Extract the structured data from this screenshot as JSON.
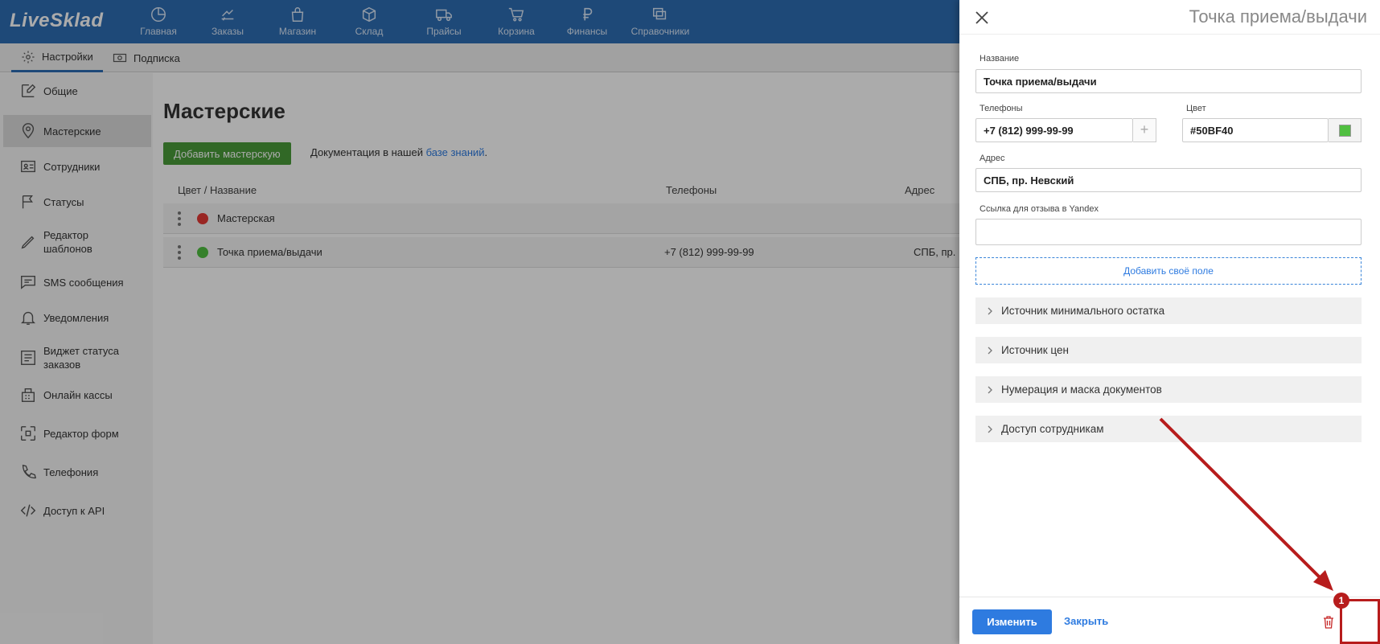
{
  "app": {
    "logo": "LiveSklad"
  },
  "nav": [
    {
      "label": "Главная",
      "icon": "dashboard-icon"
    },
    {
      "label": "Заказы",
      "icon": "orders-icon"
    },
    {
      "label": "Магазин",
      "icon": "shop-bag-icon"
    },
    {
      "label": "Склад",
      "icon": "box-icon"
    },
    {
      "label": "Прайсы",
      "icon": "truck-icon"
    },
    {
      "label": "Корзина",
      "icon": "cart-icon"
    },
    {
      "label": "Финансы",
      "icon": "ruble-icon"
    },
    {
      "label": "Справочники",
      "icon": "directory-icon"
    }
  ],
  "subnav": {
    "settings": "Настройки",
    "subscription": "Подписка"
  },
  "sidebar": {
    "items": [
      {
        "label": "Общие",
        "icon": "edit-icon"
      },
      {
        "label": "Мастерские",
        "icon": "location-pin-icon"
      },
      {
        "label": "Сотрудники",
        "icon": "id-card-icon"
      },
      {
        "label": "Статусы",
        "icon": "flag-icon"
      },
      {
        "label": "Редактор шаблонов",
        "icon": "pen-icon"
      },
      {
        "label": "SMS сообщения",
        "icon": "sms-icon"
      },
      {
        "label": "Уведомления",
        "icon": "bell-icon"
      },
      {
        "label": "Виджет статуса заказов",
        "icon": "widget-icon"
      },
      {
        "label": "Онлайн кассы",
        "icon": "cash-register-icon"
      },
      {
        "label": "Редактор форм",
        "icon": "form-editor-icon"
      },
      {
        "label": "Телефония",
        "icon": "phone-icon"
      },
      {
        "label": "Доступ к API",
        "icon": "code-icon"
      }
    ]
  },
  "main": {
    "title": "Мастерские",
    "add_button": "Добавить мастерскую",
    "docs_prefix": "Документация в нашей ",
    "docs_link": "базе знаний",
    "docs_suffix": ".",
    "columns": [
      "Цвет / Название",
      "Телефоны",
      "Адрес"
    ],
    "rows": [
      {
        "name": "Мастерская",
        "color": "#e53935",
        "phone": "",
        "address": ""
      },
      {
        "name": "Точка приема/выдачи",
        "color": "#50BF40",
        "phone": "+7 (812) 999-99-99",
        "address": "СПБ, пр. Не"
      }
    ]
  },
  "panel": {
    "title": "Точка приема/выдачи",
    "name_label": "Название",
    "name_value": "Точка приема/выдачи",
    "phones_label": "Телефоны",
    "phone_value": "+7 (812) 999-99-99",
    "color_label": "Цвет",
    "color_value": "#50BF40",
    "address_label": "Адрес",
    "address_value": "СПБ, пр. Невский",
    "review_label": "Ссылка для отзыва в Yandex",
    "review_value": "",
    "add_field": "Добавить своё поле",
    "sections": [
      "Источник минимального остатка",
      "Источник цен",
      "Нумерация и маска документов",
      "Доступ сотрудникам"
    ],
    "save_button": "Изменить",
    "close_link": "Закрыть"
  },
  "annotation": {
    "badge": "1",
    "color": "#b71c1c"
  }
}
